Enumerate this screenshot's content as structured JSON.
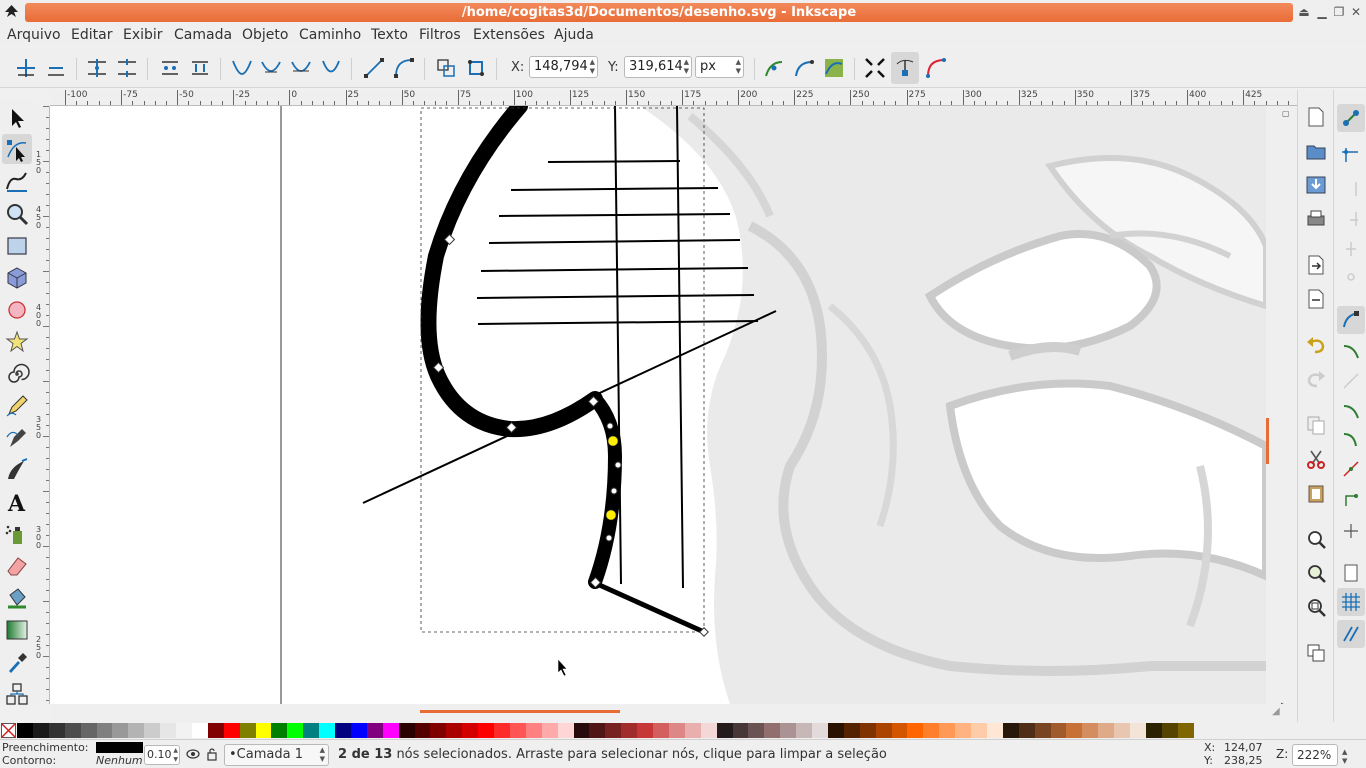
{
  "window": {
    "title": "/home/cogitas3d/Documentos/desenho.svg - Inkscape"
  },
  "menu": [
    "Arquivo",
    "Editar",
    "Exibir",
    "Camada",
    "Objeto",
    "Caminho",
    "Texto",
    "Filtros",
    "Extensões",
    "Ajuda"
  ],
  "controls": {
    "x_label": "X:",
    "x_value": "148,794",
    "y_label": "Y:",
    "y_value": "319,614",
    "unit": "px"
  },
  "ruler_top": [
    "-100",
    "-75",
    "-50",
    "-25",
    "0",
    "25",
    "50",
    "75",
    "100",
    "125",
    "150",
    "175",
    "200",
    "225",
    "250",
    "275",
    "300",
    "325",
    "350",
    "375",
    "400",
    "425"
  ],
  "ruler_left": [
    "1 5 0",
    "4 5 0",
    "4 0 0",
    "3 5 0",
    "3 0 0",
    "2 5 0"
  ],
  "status": {
    "fill_label": "Preenchimento:",
    "stroke_label": "Contorno:",
    "stroke_value": "Nenhum",
    "opacity_value": "0.10",
    "layer": "•Camada 1",
    "msg_bold": "2 de 13",
    "msg_rest": " nós selecionados. Arraste para selecionar nós, clique para limpar a seleção",
    "cursor_x_label": "X:",
    "cursor_x": "124,07",
    "cursor_y_label": "Y:",
    "cursor_y": "238,25",
    "zoom_label": "Z:",
    "zoom": "222%"
  },
  "palette": [
    "#000000",
    "#1a1a1a",
    "#333333",
    "#4d4d4d",
    "#666666",
    "#808080",
    "#999999",
    "#b3b3b3",
    "#cccccc",
    "#e6e6e6",
    "#f2f2f2",
    "#ffffff",
    "#800000",
    "#ff0000",
    "#808000",
    "#ffff00",
    "#008000",
    "#00ff00",
    "#008080",
    "#00ffff",
    "#000080",
    "#0000ff",
    "#800080",
    "#ff00ff",
    "#2b0000",
    "#550000",
    "#800000",
    "#aa0000",
    "#d40000",
    "#ff0000",
    "#ff2a2a",
    "#ff5555",
    "#ff8080",
    "#ffaaaa",
    "#ffd5d5",
    "#280b0b",
    "#501616",
    "#782121",
    "#a02c2c",
    "#c83737",
    "#d35f5f",
    "#de8787",
    "#e9afaf",
    "#f4d7d7",
    "#241c1c",
    "#483737",
    "#6c5353",
    "#916f6f",
    "#ac9393",
    "#c8b7b7",
    "#e3dbdb",
    "#2b1100",
    "#552200",
    "#803300",
    "#aa4400",
    "#d45500",
    "#ff6600",
    "#ff7f2a",
    "#ff9955",
    "#ffb380",
    "#ffccaa",
    "#ffe6d5",
    "#28170b",
    "#502d16",
    "#784421",
    "#a05a2c",
    "#c87137",
    "#d38d5f",
    "#deaa87",
    "#e9c6af",
    "#f4e3d7",
    "#2b2200",
    "#554400",
    "#806600"
  ]
}
